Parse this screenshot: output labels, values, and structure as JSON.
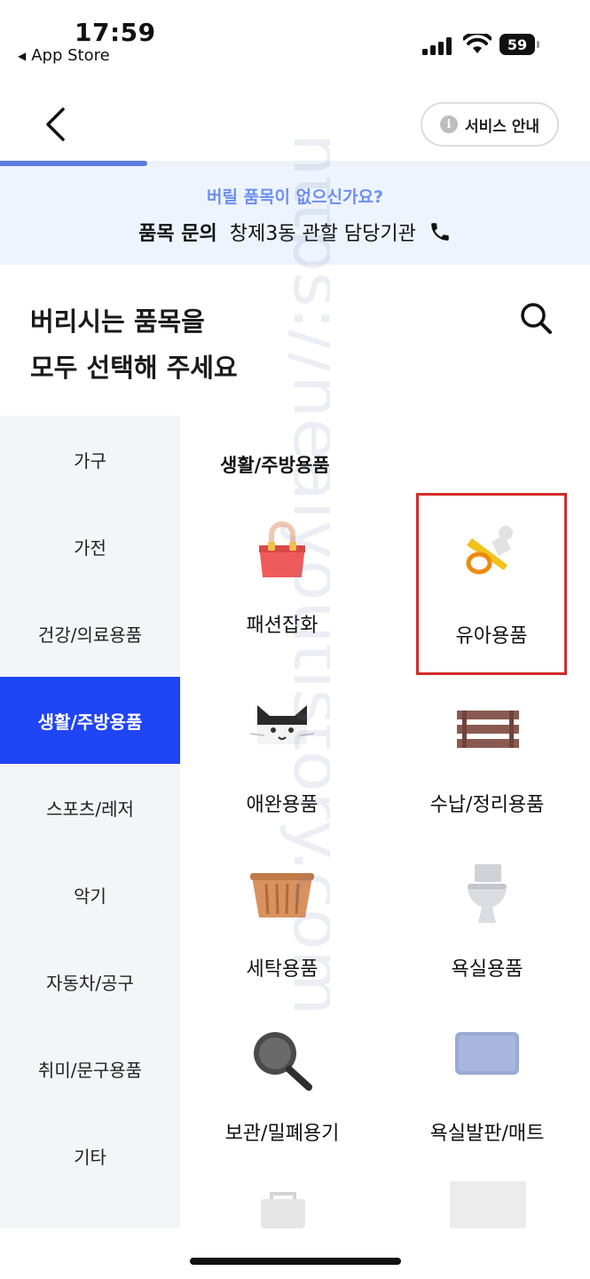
{
  "status_bar": {
    "time": "17:59",
    "back_app": "App Store",
    "battery": "59"
  },
  "header": {
    "back_icon": "chevron-left-icon",
    "service_button": "서비스 안내",
    "service_icon": "info-icon",
    "info_glyph": "i",
    "progress": 0.25
  },
  "banner": {
    "question": "버릴 품목이 없으신가요?",
    "inquiry_label": "품목 문의",
    "inquiry_text": "창제3동 관할 담당기관",
    "phone_icon": "phone-icon"
  },
  "title": {
    "line1": "버리시는 품목을",
    "line2": "모두 선택해 주세요"
  },
  "sidebar": {
    "items": [
      {
        "label": "가구"
      },
      {
        "label": "가전"
      },
      {
        "label": "건강/의료용품"
      },
      {
        "label": "생활/주방용품",
        "active": true
      },
      {
        "label": "스포츠/레저"
      },
      {
        "label": "악기"
      },
      {
        "label": "자동차/공구"
      },
      {
        "label": "취미/문구용품"
      },
      {
        "label": "기타"
      }
    ]
  },
  "content": {
    "section_title": "생활/주방용품",
    "items": [
      {
        "label": "패션잡화",
        "icon": "handbag-icon"
      },
      {
        "label": "유아용품",
        "icon": "pacifier-icon",
        "highlighted": true
      },
      {
        "label": "애완용품",
        "icon": "cat-icon"
      },
      {
        "label": "수납/정리용품",
        "icon": "shelf-icon"
      },
      {
        "label": "세탁용품",
        "icon": "laundry-basket-icon"
      },
      {
        "label": "욕실용품",
        "icon": "toilet-icon"
      },
      {
        "label": "보관/밀폐용기",
        "icon": "frying-pan-icon"
      },
      {
        "label": "욕실발판/매트",
        "icon": "bath-mat-icon"
      }
    ]
  },
  "watermark": "https://healyoutistory.com",
  "colors": {
    "accent": "#2045f5",
    "banner_bg": "#eef4fd",
    "banner_question": "#6d8ff0",
    "highlight": "#d32c2c"
  }
}
